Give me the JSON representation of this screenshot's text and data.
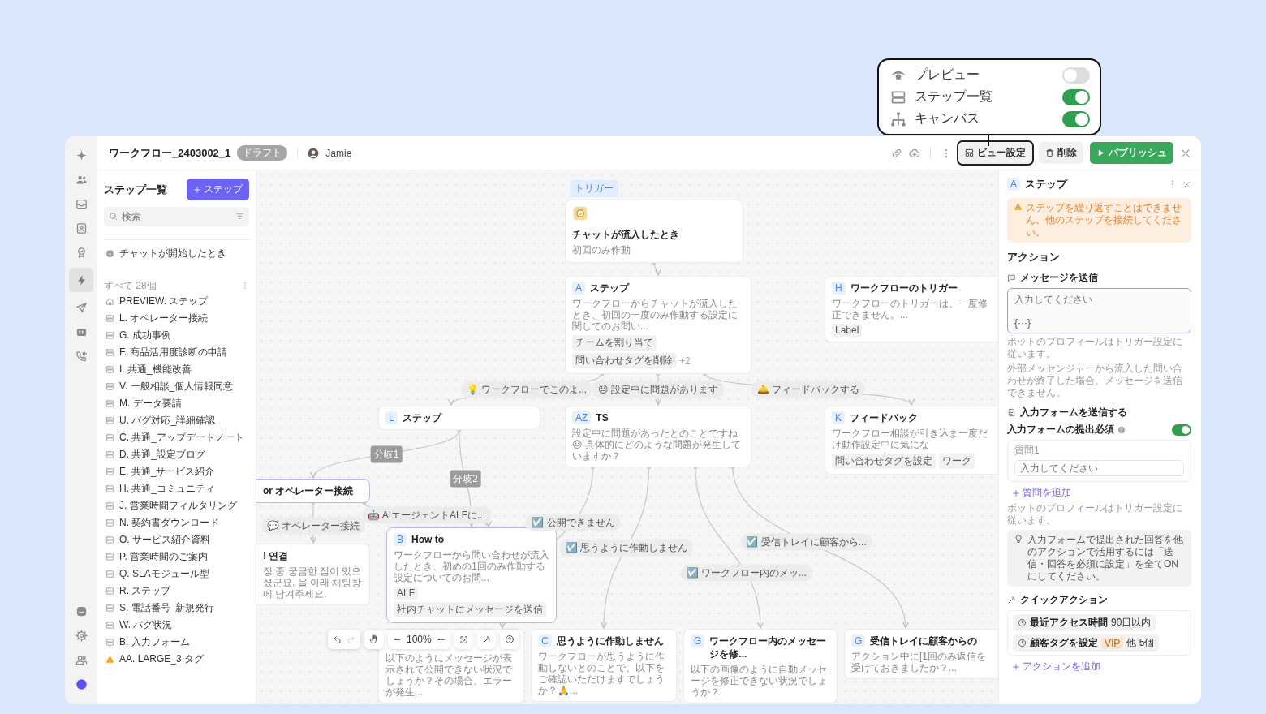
{
  "view_settings_popup": {
    "options": [
      {
        "label": "プレビュー",
        "on": false
      },
      {
        "label": "ステップ一覧",
        "on": true
      },
      {
        "label": "キャンバス",
        "on": true
      }
    ]
  },
  "nav_rail": {
    "top_items": [
      {
        "selected": false
      },
      {
        "selected": false
      },
      {
        "selected": false
      },
      {
        "selected": false
      },
      {
        "selected": false
      },
      {
        "selected": true
      },
      {
        "selected": false
      },
      {
        "selected": false
      },
      {
        "selected": false
      }
    ],
    "bottom_items": [
      {
        "selected": false
      },
      {
        "selected": false
      },
      {
        "selected": false
      },
      {
        "selected": false
      }
    ]
  },
  "header": {
    "title": "ワークフロー_2403002_1",
    "status_badge": "ドラフト",
    "user": "Jamie",
    "buttons": [
      {
        "label": "ビュー設定",
        "kind": "view",
        "highlighted": true
      },
      {
        "label": "削除",
        "kind": "delete",
        "highlighted": false
      },
      {
        "label": "パブリッシュ",
        "kind": "publish",
        "highlighted": false
      }
    ]
  },
  "step_list": {
    "title": "ステップ一覧",
    "add_button": "ステップ",
    "search": {
      "placeholder": "検索"
    },
    "trigger_item": "チャットが開始したとき",
    "count_label": "すべて 28個",
    "items": [
      {
        "label": "PREVIEW. ステップ",
        "kind": "home"
      },
      {
        "label": "L. オペレーター接続",
        "kind": "step"
      },
      {
        "label": "G. 成功事例",
        "kind": "step"
      },
      {
        "label": "F. 商品活用度診断の申請",
        "kind": "step"
      },
      {
        "label": "I. 共通_機能改善",
        "kind": "step"
      },
      {
        "label": "V. 一般相談_個人情報同意",
        "kind": "step"
      },
      {
        "label": "M. データ要請",
        "kind": "step"
      },
      {
        "label": "U. バグ対応_詳細確認",
        "kind": "step"
      },
      {
        "label": "C. 共通_アップデートノート",
        "kind": "step"
      },
      {
        "label": "D. 共通_設定ブログ",
        "kind": "step"
      },
      {
        "label": "E. 共通_サービス紹介",
        "kind": "step"
      },
      {
        "label": "H. 共通_コミュニティ",
        "kind": "step"
      },
      {
        "label": "J. 営業時間フィルタリング",
        "kind": "step"
      },
      {
        "label": "N. 契約書ダウンロード",
        "kind": "step"
      },
      {
        "label": "O. サービス紹介資料",
        "kind": "step"
      },
      {
        "label": "P. 営業時間のご案内",
        "kind": "step"
      },
      {
        "label": "Q. SLAモジュール型",
        "kind": "step"
      },
      {
        "label": "R. ステップ",
        "kind": "step"
      },
      {
        "label": "S. 電話番号_新規発行",
        "kind": "step"
      },
      {
        "label": "W. バグ状況",
        "kind": "step"
      },
      {
        "label": "B. 入力フォーム",
        "kind": "step"
      },
      {
        "label": "AA. LARGE_3 タグ",
        "kind": "warning"
      }
    ]
  },
  "canvas": {
    "trigger_tag": "トリガー",
    "nodes": [
      {
        "kind": "trigger",
        "title": "チャットが流入したとき",
        "subtitle": "初回のみ作動",
        "highlighted": false
      },
      {
        "kind": "step",
        "badge": "A",
        "title": "ステップ",
        "description": "ワークフローからチャットが流入したとき、初回の一度のみ作動する設定に関してのお問い...",
        "tags": [
          "チームを割り当て",
          "問い合わせタグを削除"
        ],
        "more": "+2",
        "highlighted": false
      },
      {
        "kind": "step",
        "badge": "H",
        "title": "ワークフローのトリガー",
        "description": "ワークフローのトリガーは、一度修正できません。...",
        "tags": [
          "Label"
        ],
        "highlighted": false
      },
      {
        "kind": "step",
        "badge": "L",
        "title": "ステップ",
        "highlighted": false
      },
      {
        "kind": "step",
        "badge": "AZ",
        "title": "TS",
        "description": "設定中に問題があったとのことですね😓 具体的にどのような問題が発生していますか？",
        "highlighted": false
      },
      {
        "kind": "step",
        "badge": "K",
        "title": "フィードバック",
        "description": "ワークフロー相談が引き込ま一度だけ動作設定中に気にな",
        "tags": [
          "問い合わせタグを設定",
          "ワーク"
        ],
        "highlighted": false
      },
      {
        "kind": "step",
        "title": "or オペレーター接続",
        "highlighted": true
      },
      {
        "kind": "step",
        "title": "! 연결",
        "description": "정 중 궁금한 점이 있으셨군요. 을 아래 채팅창에 남겨주세요.",
        "highlighted": false
      },
      {
        "kind": "step",
        "badge": "B",
        "title": "How to",
        "description": "ワークフローから問い合わせが流入したとき、初めの1回のみ作動する設定についてのお問...",
        "tags": [
          "ALF",
          "社内チャットにメッセージを送信"
        ],
        "highlighted": true
      },
      {
        "kind": "step",
        "description": "以下のようにメッセージが表示されて公開できない状況でしょうか？その場合、エラーが発生...",
        "highlighted": false
      },
      {
        "kind": "step",
        "badge": "C",
        "title": "思うように作動しません",
        "description": "ワークフローが思うように作動しないとのことで、以下をご確認いただけますでしょうか？🙏...",
        "highlighted": false
      },
      {
        "kind": "step",
        "badge": "G",
        "title": "ワークフロー内のメッセージを修...",
        "description": "以下の画像のように自動メッセージを修正できない状況でしょうか？",
        "highlighted": false
      },
      {
        "kind": "step",
        "badge": "G",
        "title": "受信トレイに顧客からの",
        "description": "アクション中に[1回のみ返信を受けておきましたか？...",
        "highlighted": false
      }
    ],
    "edge_labels": [
      {
        "kind": "pill",
        "text": "💡 ワークフローでこのよ..."
      },
      {
        "kind": "pill",
        "text": "😓 設定中に問題があります"
      },
      {
        "kind": "pill",
        "text": "🛎️ フィードバックする"
      },
      {
        "kind": "branch",
        "text": "分岐1"
      },
      {
        "kind": "branch",
        "text": "分岐2"
      },
      {
        "kind": "pill",
        "text": "🤖 AIエージェントALFに..."
      },
      {
        "kind": "pill",
        "text": "💬 オペレーター接続"
      },
      {
        "kind": "pill",
        "text": "☑️ 公開できません"
      },
      {
        "kind": "pill",
        "text": "☑️ 思うように作動しません"
      },
      {
        "kind": "pill",
        "text": "☑️ ワークフロー内のメッ..."
      },
      {
        "kind": "pill",
        "text": "☑️ 受信トレイに顧客から..."
      }
    ],
    "zoom_toolbar": {
      "zoom": "100%"
    }
  },
  "inspector": {
    "badge": "A",
    "title": "ステップ",
    "warning": "ステップを繰り返すことはできません。他のステップを接続してください。",
    "section_title": "アクション",
    "message_action": {
      "title": "メッセージを送信",
      "placeholder": "入力してください",
      "variable_button": "{···}",
      "notes": [
        "ボットのプロフィールはトリガー設定に従います。",
        "外部メッセンジャーから流入した問い合わせが終了した場合、メッセージを送信できません。"
      ]
    },
    "form_action": {
      "title": "入力フォームを送信する",
      "required_label": "入力フォームの提出必須",
      "required_on": true,
      "question_label": "質問1",
      "question_placeholder": "入力してください",
      "add_question": "質問を追加",
      "note": "ボットのプロフィールはトリガー設定に従います。",
      "tip": "入力フォームで提出された回答を他のアクションで活用するには「送信・回答を必須に設定」を全てONにしてください。"
    },
    "quick_actions": {
      "title": "クイックアクション",
      "items": [
        {
          "label": "最近アクセス時間",
          "value": "90日以内"
        },
        {
          "label": "顧客タグを設定",
          "tag": "VIP",
          "value": "他 5個"
        }
      ],
      "add_action": "アクションを追加"
    }
  }
}
